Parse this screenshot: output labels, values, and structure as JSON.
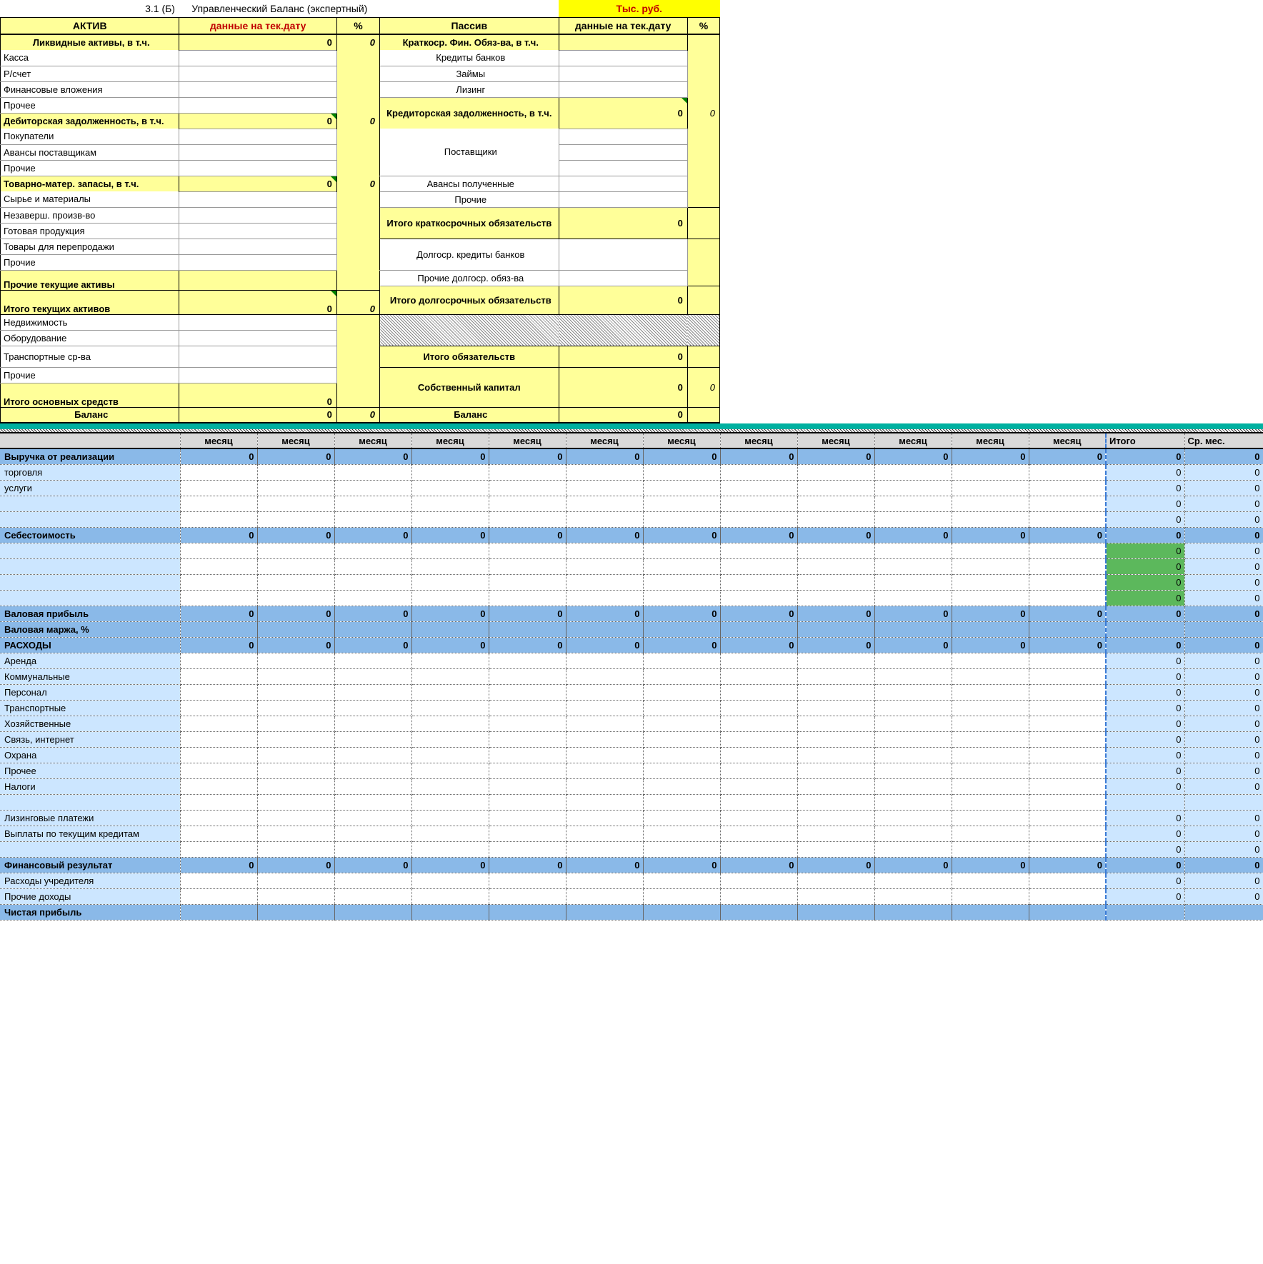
{
  "balance": {
    "title_num": "3.1 (Б)",
    "title_text": "Управленческий Баланс (экспертный)",
    "unit": "Тыс. руб.",
    "headers": {
      "asset": "АКТИВ",
      "asset_data": "данные на тек.дату",
      "pct": "%",
      "liab": "Пассив",
      "liab_data": "данные на тек.дату"
    },
    "asset": {
      "liquid": {
        "label": "Ликвидные активы, в т.ч.",
        "value": "0",
        "pct": "0"
      },
      "kassa": "Касса",
      "rschet": "Р/счет",
      "fin_vloz": "Финансовые вложения",
      "prochee1": "Прочее",
      "debit": {
        "label": "Дебиторская задолженность, в т.ч.",
        "value": "0",
        "pct": "0"
      },
      "pokup": "Покупатели",
      "avansy_post": "Авансы поставщикам",
      "prochie2": "Прочие",
      "tmz": {
        "label": "Товарно-матер. запасы, в т.ч.",
        "value": "0",
        "pct": "0"
      },
      "syrie": "Сырье и материалы",
      "nezav": "Незаверш. произв-во",
      "gotov": "Готовая продукция",
      "tovary": "Товары для перепродажи",
      "prochie3": "Прочие",
      "other_curr": {
        "label": "Прочие текущие активы"
      },
      "total_curr": {
        "label": "Итого текущих активов",
        "value": "0",
        "pct": "0"
      },
      "nedvizh": "Недвижимость",
      "oborud": "Оборудование",
      "transp": "Транспортные ср-ва",
      "prochie4": "Прочие",
      "total_os": {
        "label": "Итого основных средств",
        "value": "0"
      },
      "balance": {
        "label": "Баланс",
        "value": "0",
        "pct": "0"
      }
    },
    "liab": {
      "kratk": {
        "label": "Краткоср. Фин. Обяз-ва, в т.ч."
      },
      "kredity": "Кредиты банков",
      "zaimy": "Займы",
      "lizing": "Лизинг",
      "kredit": {
        "label": "Кредиторская задолженность, в т.ч.",
        "value": "0",
        "pct": "0"
      },
      "postavsh": "Поставщики",
      "avansy_pol": "Авансы полученные",
      "prochie": "Прочие",
      "total_kratk": {
        "label": "Итого краткосрочных обязательств",
        "value": "0"
      },
      "dolg_kred": "Долгоср. кредиты банков",
      "other_dolg": "Прочие долгоср. обяз-ва",
      "total_dolg": {
        "label": "Итого долгосрочных обязательств",
        "value": "0"
      },
      "total_obyaz": {
        "label": "Итого обязательств",
        "value": "0"
      },
      "equity": {
        "label": "Собственный капитал",
        "value": "0",
        "pct": "0"
      },
      "balance": {
        "label": "Баланс",
        "value": "0"
      }
    }
  },
  "pl": {
    "hdr_month": "месяц",
    "hdr_total": "Итого",
    "hdr_avg": "Ср. мес.",
    "rows": {
      "revenue": {
        "label": "Выручка от реализации",
        "m": [
          "0",
          "0",
          "0",
          "0",
          "0",
          "0",
          "0",
          "0",
          "0",
          "0",
          "0",
          "0"
        ],
        "total": "0",
        "avg": "0"
      },
      "torg": {
        "label": "торговля",
        "total": "0",
        "avg": "0"
      },
      "uslugi": {
        "label": "услуги",
        "total": "0",
        "avg": "0"
      },
      "blank1": {
        "total": "0",
        "avg": "0"
      },
      "blank2": {
        "total": "0",
        "avg": "0"
      },
      "cogs": {
        "label": "Себестоимость",
        "m": [
          "0",
          "0",
          "0",
          "0",
          "0",
          "0",
          "0",
          "0",
          "0",
          "0",
          "0",
          "0"
        ],
        "total": "0",
        "avg": "0"
      },
      "c1": {
        "total": "0",
        "avg": "0"
      },
      "c2": {
        "total": "0",
        "avg": "0"
      },
      "c3": {
        "total": "0",
        "avg": "0"
      },
      "c4": {
        "total": "0",
        "avg": "0"
      },
      "gross": {
        "label": "Валовая прибыль",
        "m": [
          "0",
          "0",
          "0",
          "0",
          "0",
          "0",
          "0",
          "0",
          "0",
          "0",
          "0",
          "0"
        ],
        "total": "0",
        "avg": "0"
      },
      "margin": {
        "label": "Валовая маржа, %"
      },
      "exp": {
        "label": "РАСХОДЫ",
        "m": [
          "0",
          "0",
          "0",
          "0",
          "0",
          "0",
          "0",
          "0",
          "0",
          "0",
          "0",
          "0"
        ],
        "total": "0",
        "avg": "0"
      },
      "arenda": {
        "label": "Аренда",
        "total": "0",
        "avg": "0"
      },
      "kommun": {
        "label": "Коммунальные",
        "total": "0",
        "avg": "0"
      },
      "personal": {
        "label": "Персонал",
        "total": "0",
        "avg": "0"
      },
      "transp": {
        "label": "Транспортные",
        "total": "0",
        "avg": "0"
      },
      "hoz": {
        "label": "Хозяйственные",
        "total": "0",
        "avg": "0"
      },
      "svyaz": {
        "label": "Связь, интернет",
        "total": "0",
        "avg": "0"
      },
      "ohrana": {
        "label": "Охрана",
        "total": "0",
        "avg": "0"
      },
      "prochee": {
        "label": "Прочее",
        "total": "0",
        "avg": "0"
      },
      "nalogi": {
        "label": "Налоги",
        "total": "0",
        "avg": "0"
      },
      "liz": {
        "label": "Лизинговые платежи",
        "total": "0",
        "avg": "0"
      },
      "vypl": {
        "label": "Выплаты по текущим кредитам",
        "total": "0",
        "avg": "0"
      },
      "blank3": {
        "total": "0",
        "avg": "0"
      },
      "finres": {
        "label": "Финансовый результат",
        "m": [
          "0",
          "0",
          "0",
          "0",
          "0",
          "0",
          "0",
          "0",
          "0",
          "0",
          "0",
          "0"
        ],
        "total": "0",
        "avg": "0"
      },
      "rasuch": {
        "label": "Расходы учредителя",
        "total": "0",
        "avg": "0"
      },
      "prdoh": {
        "label": "Прочие доходы",
        "total": "0",
        "avg": "0"
      },
      "net": {
        "label": "Чистая прибыль"
      }
    }
  }
}
